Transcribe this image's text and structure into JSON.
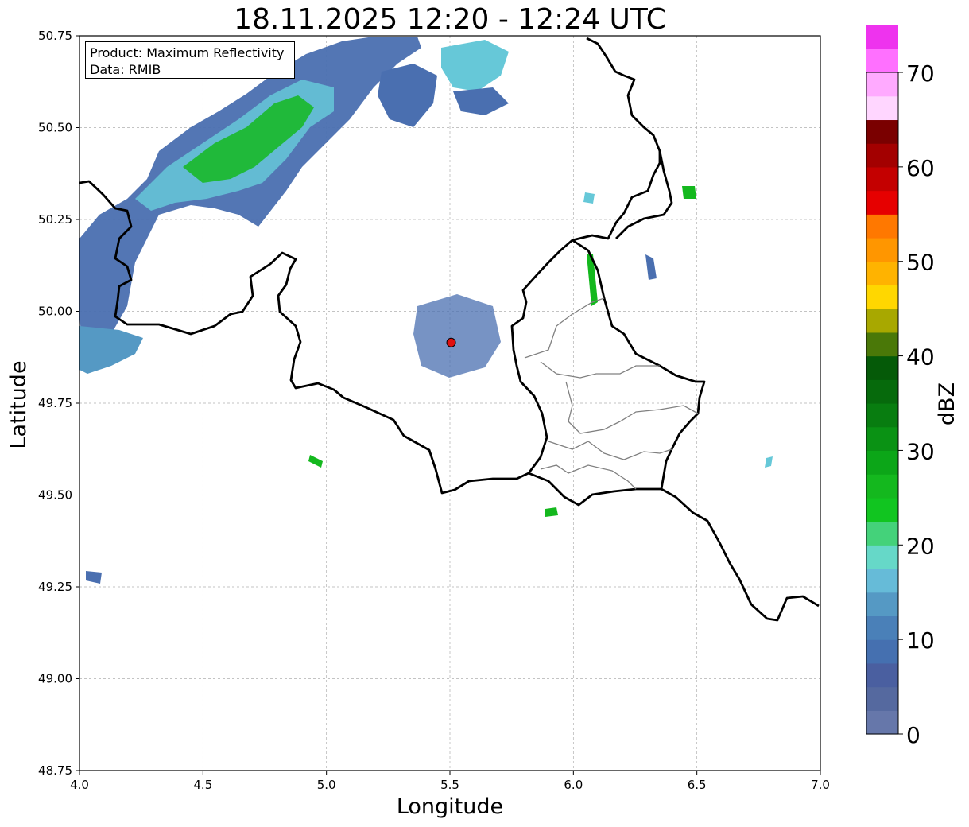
{
  "title": "18.11.2025 12:20 - 12:24 UTC",
  "info_box": {
    "line1": "Product: Maximum Reflectivity",
    "line2": "Data: RMIB"
  },
  "axes": {
    "xlabel": "Longitude",
    "ylabel": "Latitude",
    "xlim": [
      4.0,
      7.0
    ],
    "ylim": [
      48.75,
      50.75
    ],
    "xticks": [
      "4.0",
      "4.5",
      "5.0",
      "5.5",
      "6.0",
      "6.5",
      "7.0"
    ],
    "yticks": [
      "48.75",
      "49.00",
      "49.25",
      "49.50",
      "49.75",
      "50.00",
      "50.25",
      "50.50",
      "50.75"
    ],
    "grid": true
  },
  "radar_site": {
    "lon": 5.505,
    "lat": 49.915,
    "color": "#e01010"
  },
  "colorbar": {
    "label": "dBZ",
    "ticks": [
      "0",
      "10",
      "20",
      "30",
      "40",
      "50",
      "60",
      "70"
    ],
    "range": [
      0,
      70
    ],
    "step": 2.5,
    "colors": [
      "#6677aa",
      "#55699f",
      "#4a5fa0",
      "#4570b0",
      "#4a80b8",
      "#5599c4",
      "#66bbd8",
      "#66d8c8",
      "#44d27a",
      "#11c520",
      "#14b81e",
      "#0ca618",
      "#0a9214",
      "#087d10",
      "#066a0c",
      "#055a08",
      "#4a7808",
      "#a8a800",
      "#ffd700",
      "#ffb300",
      "#ff9600",
      "#ff7800",
      "#e60000",
      "#c40000",
      "#a30000",
      "#7a0000",
      "#ffd6ff",
      "#ffaaff",
      "#ff70ff",
      "#ee33ee"
    ]
  },
  "chart_data": {
    "type": "heatmap",
    "title": "18.11.2025 12:20 - 12:24 UTC",
    "xlabel": "Longitude",
    "ylabel": "Latitude",
    "xlim": [
      4.0,
      7.0
    ],
    "ylim": [
      48.75,
      50.75
    ],
    "colorbar_label": "dBZ",
    "colorbar_range": [
      0,
      70
    ],
    "precip_regions": [
      {
        "name": "northwest band",
        "lon_range": [
          4.2,
          5.2
        ],
        "lat_range": [
          50.25,
          50.75
        ],
        "max_dbz": 25
      },
      {
        "name": "west edge",
        "lon_range": [
          4.0,
          4.25
        ],
        "lat_range": [
          49.85,
          50.25
        ],
        "max_dbz": 20
      },
      {
        "name": "north patches",
        "lon_range": [
          5.2,
          5.9
        ],
        "lat_range": [
          50.45,
          50.75
        ],
        "max_dbz": 20
      }
    ]
  }
}
